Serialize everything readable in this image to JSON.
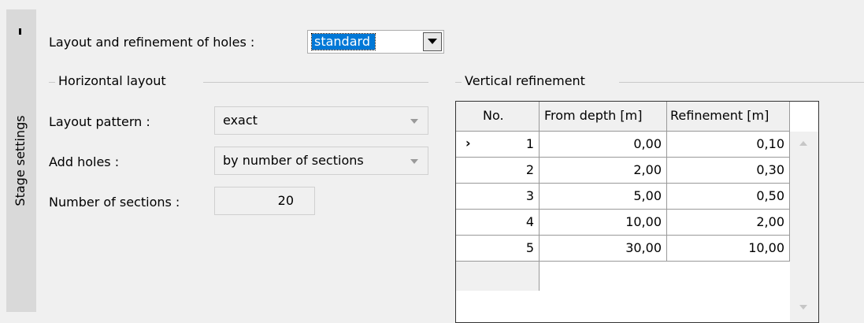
{
  "stage_tab": {
    "label": "Stage settings"
  },
  "layout_refinement": {
    "label": "Layout and refinement of holes :",
    "value": "standard"
  },
  "horizontal_layout": {
    "title": "Horizontal layout",
    "layout_pattern_label": "Layout pattern :",
    "layout_pattern_value": "exact",
    "add_holes_label": "Add holes :",
    "add_holes_value": "by number of sections",
    "num_sections_label": "Number of sections :",
    "num_sections_value": "20"
  },
  "vertical_refinement": {
    "title": "Vertical refinement",
    "columns": [
      "No.",
      "From depth [m]",
      "Refinement [m]"
    ],
    "rows": [
      {
        "no": "1",
        "from_depth": "0,00",
        "refinement": "0,10"
      },
      {
        "no": "2",
        "from_depth": "2,00",
        "refinement": "0,30"
      },
      {
        "no": "3",
        "from_depth": "5,00",
        "refinement": "0,50"
      },
      {
        "no": "4",
        "from_depth": "10,00",
        "refinement": "2,00"
      },
      {
        "no": "5",
        "from_depth": "30,00",
        "refinement": "10,00"
      }
    ]
  }
}
